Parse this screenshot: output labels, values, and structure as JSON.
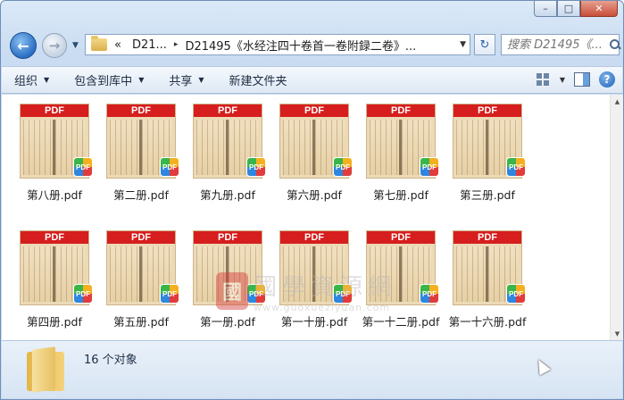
{
  "window": {
    "caption": {
      "minimize": "–",
      "maximize": "□",
      "close": "✕"
    }
  },
  "nav": {
    "back": "←",
    "forward": "→",
    "address": {
      "overflow": "«",
      "crumbs": [
        "D21...",
        "D21495《水经注四十卷首一卷附録二卷》..."
      ],
      "sep": "▸"
    },
    "refresh": "↻",
    "search": {
      "placeholder": "搜索 D21495《..."
    }
  },
  "toolbar": {
    "items": [
      {
        "label": "组织",
        "dropdown": true
      },
      {
        "label": "包含到库中",
        "dropdown": true
      },
      {
        "label": "共享",
        "dropdown": true
      },
      {
        "label": "新建文件夹",
        "dropdown": false
      }
    ],
    "help": "?"
  },
  "files": {
    "badge": "PDF",
    "items": [
      {
        "name": "第八册.pdf"
      },
      {
        "name": "第二册.pdf"
      },
      {
        "name": "第九册.pdf"
      },
      {
        "name": "第六册.pdf"
      },
      {
        "name": "第七册.pdf"
      },
      {
        "name": "第三册.pdf"
      },
      {
        "name": "第四册.pdf"
      },
      {
        "name": "第五册.pdf"
      },
      {
        "name": "第一册.pdf"
      },
      {
        "name": "第一十册.pdf"
      },
      {
        "name": "第一十二册.pdf"
      },
      {
        "name": "第一十六册.pdf"
      }
    ]
  },
  "watermark": {
    "seal": "國",
    "text": "國學資源網",
    "url": "www.guoxueziyuan.com"
  },
  "details": {
    "count": "16 个对象"
  },
  "colors": {
    "pdf_band": "#d61e1e",
    "window_frame": "#c9dcf1"
  }
}
